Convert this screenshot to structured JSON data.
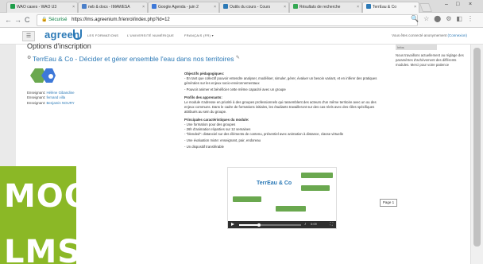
{
  "tabs": [
    {
      "label": "WAO cases - WAO U3",
      "color": "#1e9e4a"
    },
    {
      "label": "rwb & docs - IMAWESA",
      "color": "#4a7fc9"
    },
    {
      "label": "Google Agenda - juin 2",
      "color": "#3d78d8"
    },
    {
      "label": "Outils du cours - Cours",
      "color": "#2b79b6"
    },
    {
      "label": "Résultats de recherche",
      "color": "#34a853"
    },
    {
      "label": "TerrEau & Co",
      "color": "#2b79b6"
    }
  ],
  "address": {
    "secure_label": "Sécurisé",
    "url": "https://lms.agreenium.fr/enrol/index.php?id=12"
  },
  "site": {
    "brand": "agreen",
    "nav": [
      "LES FORMATIONS",
      "L'UNIVERSITÉ NUMÉRIQUE",
      "FRANÇAIS (FR) ▾"
    ],
    "login_note": "Vous êtes connecté anonymement",
    "login_link": "(Connexion)"
  },
  "page": {
    "options_title": "Options d'inscription",
    "course_title": "TerrEau & Co - Décider et gérer ensemble l'eau dans nos territoires",
    "teachers": [
      {
        "role": "Enseignant:",
        "name": "Hélène Gibandine"
      },
      {
        "role": "Enseignant:",
        "name": "fernand villa"
      },
      {
        "role": "Enseignant:",
        "name": "Benjamin NOURY"
      }
    ],
    "sidebox_header": "Infos",
    "sidebox_text": "Nous travaillons actuellement au réglage des paramètres d'achèvement des différents modules. Merci pour votre patience"
  },
  "description": {
    "objectives_h": "Objectifs pédagogiques:",
    "objectives_1": "- En tant que collectif pouvoir entendre analyser, modéliser, simuler, gérer, évaluer un besoin variant, et en inférer des pratiques générales sur les enjeux socio-environnementaux",
    "objectives_2": "- Pouvoir animer et bénéficier cette même capacité avec un groupe",
    "profile_h": "Profils des apprenants:",
    "profile_1": "Le module s'adresse en priorité à des groupes professionnels qui rassemblent des acteurs d'un même territoire avec un ou des enjeux communs. Dans le cadre de formations initiales, les étudiants travailleront sur des cas réels avec des rôles spécifiques attribués au sein du groupe.",
    "features_h": "Principales caractéristiques du module:",
    "features_1": "- Une formation pour des groupes",
    "features_2": "- 26h d'animation réparties sur 12 semaines",
    "features_3": "- \"blended\": distanciel sur des éléments de contenu, présentiel avec animation à distance, classe virtuelle",
    "features_4": "- Une évaluation mixte: enseignant, pair, endoreau",
    "features_5": "- Un dispositif transférable"
  },
  "video": {
    "title": "TerrEau & Co",
    "time": "0:09",
    "progress": 0.32
  },
  "page_indicator": "Page 1",
  "overlay": {
    "line1": "MOOC",
    "line2": "LMS",
    "color": "#8bb826"
  },
  "colors": {
    "accent": "#2b79b6",
    "green": "#6aa84f"
  }
}
